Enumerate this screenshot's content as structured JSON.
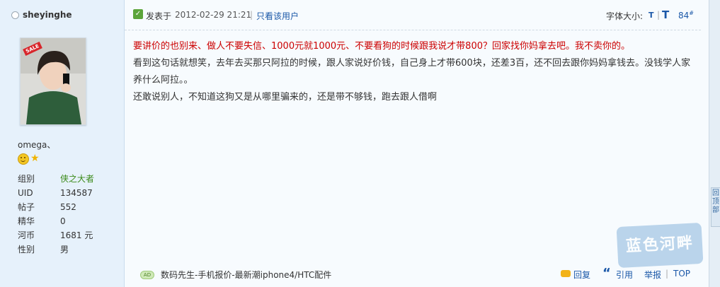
{
  "user": {
    "name": "sheyinghe",
    "avatar_tag": "SALE",
    "title": "omega、",
    "stats": [
      {
        "label": "组别",
        "value": "侠之大者",
        "color": "#3a8a18"
      },
      {
        "label": "UID",
        "value": "134587"
      },
      {
        "label": "帖子",
        "value": "552"
      },
      {
        "label": "精华",
        "value": "0"
      },
      {
        "label": "河币",
        "value": "1681 元"
      },
      {
        "label": "性别",
        "value": "男"
      }
    ],
    "medal_icons": [
      "smiley-medal-icon",
      "star-medal-icon"
    ]
  },
  "post": {
    "posted_label": "发表于",
    "time": "2012-02-29 21:21",
    "separator": "|",
    "only_author": "只看该用户",
    "font_size_label": "字体大小:",
    "font_small": "T",
    "font_large": "T",
    "floor": "84",
    "floor_sup": "#",
    "lines": [
      "要讲价的也别来、做人不要失信、1000元就1000元、不要看狗的时候跟我说才带800？回家找你妈拿去吧。我不卖你的。",
      "看到这句话就想笑，去年去买那只阿拉的时候，跟人家说好价钱，自己身上才带600块，还差3百，还不回去跟你妈妈拿钱去。没钱学人家养什么阿拉。。",
      "还敢说别人，不知道这狗又是从哪里骗来的，还是带不够钱，跑去跟人借啊"
    ],
    "red_color": "#cc0000"
  },
  "footer": {
    "ad_badge": "AD",
    "ad_text": "数码先生-手机报价-最新潮iphone4/HTC配件",
    "reply": "回复",
    "quote": "引用",
    "report": "举报",
    "separator": "|",
    "top": "TOP"
  },
  "side_tab": "回顶部",
  "watermark": "蓝色河畔",
  "colors": {
    "link": "#1b58a8",
    "sidebar_bg": "#e6f1fb",
    "main_bg": "#f7fbfe"
  }
}
